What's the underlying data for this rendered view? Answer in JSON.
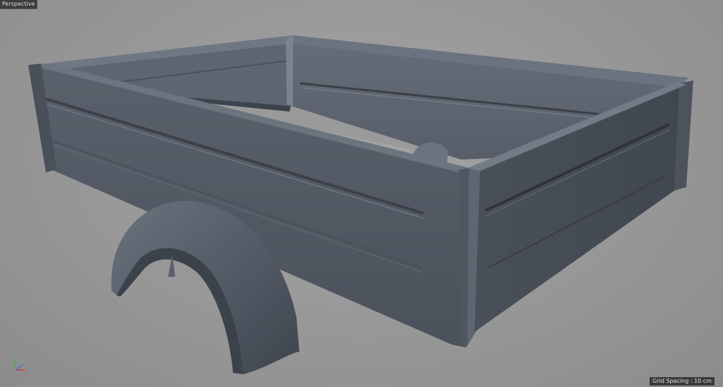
{
  "viewport": {
    "label": "Perspective",
    "grid_spacing": "Grid Spacing : 10 cm"
  },
  "colors": {
    "background": "#979797",
    "model_dark": "#3f4550",
    "model_mid": "#555c68",
    "model_light": "#6c7480",
    "axis_x": "#d03a3a",
    "axis_y": "#4caf50",
    "axis_z": "#3f6fd8"
  },
  "icons": {
    "axis_gizmo": "xyz-axis-icon"
  }
}
